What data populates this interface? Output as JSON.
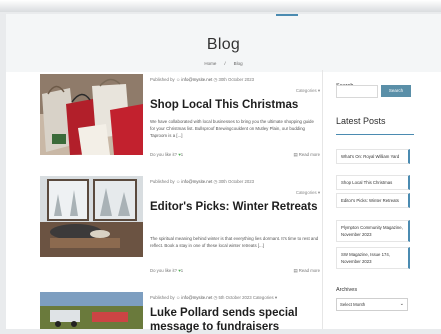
{
  "page": {
    "title": "Blog",
    "breadcrumb": [
      "Home",
      "/",
      "Blog"
    ]
  },
  "posts": [
    {
      "meta_published": "Published by",
      "meta_author": "info@mysite.net",
      "meta_date": "30th October 2023",
      "categories": "Categories ▾",
      "title": "Shop Local This Christmas",
      "excerpt": "We have collaborated with local businesses to bring you the ultimate shopping guide for your Christmas list. Bullsproof Brewingcouldent on Mutley Plain, our budding Taproom is a [...]",
      "likes": "Do you like it?",
      "like_count": "1",
      "read_more": "Read more"
    },
    {
      "meta_published": "Published by",
      "meta_author": "info@mysite.net",
      "meta_date": "30th October 2023",
      "categories": "Categories ▾",
      "title": "Editor's Picks: Winter Retreats",
      "excerpt": "The spiritual meaning behind winter is that everything lies dormant. It's time to rest and reflect. Book a stay in one of these local winter retreats [...]",
      "likes": "Do you like it?",
      "like_count": "1",
      "read_more": "Read more"
    },
    {
      "meta_published": "Published by",
      "meta_author": "info@mysite.net",
      "meta_date": "5th October 2023",
      "categories": "Categories ▾",
      "title": "Luke Pollard sends special message to fundraisers"
    }
  ],
  "sidebar": {
    "search_label": "Search",
    "search_button": "Search",
    "latest_heading": "Latest Posts",
    "latest_items": [
      "What's On: Royal William Yard",
      "Shop Local This Christmas",
      "Editor's Picks: Winter Retreats",
      "Plympton Community Magazine, November 2023",
      "SW Magazine, Issue 174, November 2023"
    ],
    "archives_heading": "Archives",
    "archives_select": "Select Month"
  },
  "colors": {
    "accent": "#4b8bb1",
    "button": "#5a8fa8",
    "heart": "#4caf50"
  }
}
